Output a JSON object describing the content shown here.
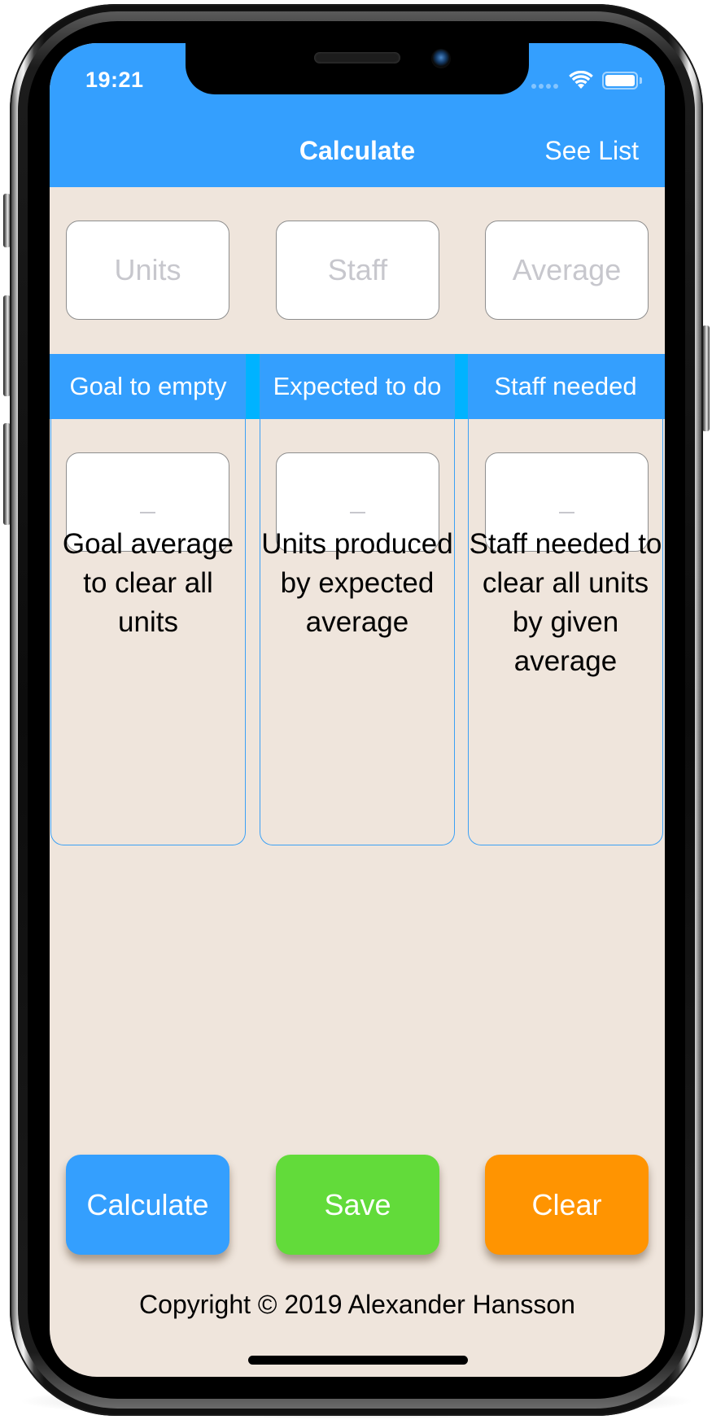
{
  "status_bar": {
    "time": "19:21",
    "icons": [
      "signal-dots-icon",
      "wifi-icon",
      "battery-icon"
    ]
  },
  "navbar": {
    "title": "Calculate",
    "right_button": "See List"
  },
  "inputs": [
    {
      "placeholder": "Units",
      "value": ""
    },
    {
      "placeholder": "Staff",
      "value": ""
    },
    {
      "placeholder": "Average",
      "value": ""
    }
  ],
  "columns": [
    {
      "header": "Goal to empty",
      "output": "–",
      "description": "Goal average to clear all units"
    },
    {
      "header": "Expected to do",
      "output": "–",
      "description": "Units produced by expected average"
    },
    {
      "header": "Staff needed",
      "output": "–",
      "description": "Staff needed to clear all units by given average"
    }
  ],
  "buttons": {
    "calculate": "Calculate",
    "save": "Save",
    "clear": "Clear"
  },
  "footer": {
    "copyright": "Copyright © 2019 Alexander Hansson"
  },
  "colors": {
    "primary_blue": "#349ffe",
    "header_gap_cyan": "#00b3ff",
    "background": "#efe5dc",
    "save_green": "#62db3a",
    "clear_orange": "#ff9401",
    "placeholder_gray": "#c7c7cd"
  }
}
